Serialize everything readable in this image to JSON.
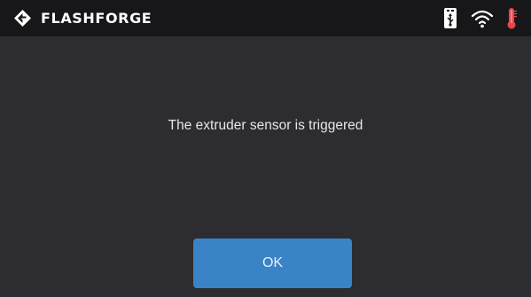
{
  "header": {
    "brand": "FLASHFORGE",
    "logo_icon": "flashforge-logo-icon",
    "status_icons": [
      "usb-icon",
      "wifi-icon",
      "thermometer-icon"
    ]
  },
  "dialog": {
    "message": "The extruder sensor is triggered",
    "ok_label": "OK"
  },
  "colors": {
    "topbar_background": "#171719",
    "screen_background": "#2d2c30",
    "button_accent": "#3a83c6",
    "temperature_indicator": "#e8454a"
  }
}
